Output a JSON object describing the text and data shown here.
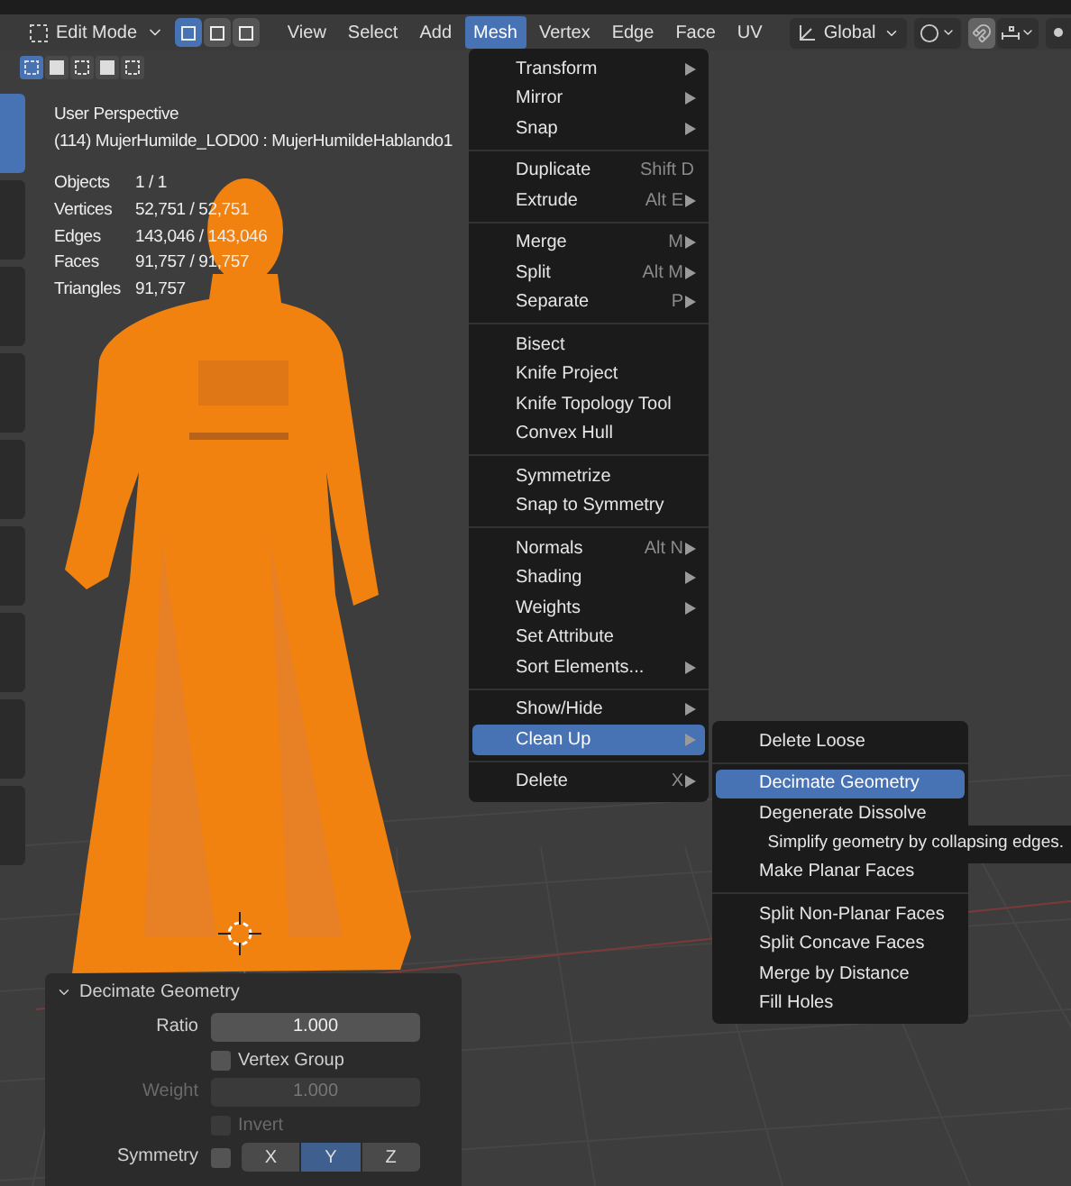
{
  "header": {
    "mode": "Edit Mode",
    "select_modes": [
      {
        "selected": true
      },
      {
        "selected": false
      },
      {
        "selected": false
      }
    ],
    "menus": [
      {
        "label": "View",
        "selected": false
      },
      {
        "label": "Select",
        "selected": false
      },
      {
        "label": "Add",
        "selected": false
      },
      {
        "label": "Mesh",
        "selected": true
      },
      {
        "label": "Vertex",
        "selected": false
      },
      {
        "label": "Edge",
        "selected": false
      },
      {
        "label": "Face",
        "selected": false
      },
      {
        "label": "UV",
        "selected": false
      }
    ],
    "orientation": "Global",
    "snap_on": true
  },
  "selection_tools": [
    {
      "selected": true
    },
    {
      "selected": false
    },
    {
      "selected": false
    },
    {
      "selected": false
    },
    {
      "selected": false
    }
  ],
  "toolbar": [
    {
      "selected": true
    },
    {
      "selected": false
    },
    {
      "selected": false
    },
    {
      "selected": false
    },
    {
      "selected": false
    },
    {
      "selected": false
    },
    {
      "selected": false
    },
    {
      "selected": false
    },
    {
      "selected": false
    }
  ],
  "viewport_info": {
    "view": "User Perspective",
    "object": "(114) MujerHumilde_LOD00 : MujerHumildeHablando1",
    "stats": [
      {
        "label": "Objects",
        "value": "1 / 1"
      },
      {
        "label": "Vertices",
        "value": "52,751 / 52,751"
      },
      {
        "label": "Edges",
        "value": "143,046 / 143,046"
      },
      {
        "label": "Faces",
        "value": "91,757 / 91,757"
      },
      {
        "label": "Triangles",
        "value": "91,757"
      }
    ]
  },
  "mesh_menu": [
    [
      {
        "label": "Transform",
        "submenu": true,
        "selected": false
      },
      {
        "label": "Mirror",
        "submenu": true,
        "selected": false
      },
      {
        "label": "Snap",
        "submenu": true,
        "selected": false
      }
    ],
    [
      {
        "label": "Duplicate",
        "shortcut": "Shift D",
        "submenu": false,
        "selected": false
      },
      {
        "label": "Extrude",
        "shortcut": "Alt E",
        "submenu": true,
        "selected": false
      }
    ],
    [
      {
        "label": "Merge",
        "shortcut": "M",
        "submenu": true,
        "selected": false
      },
      {
        "label": "Split",
        "shortcut": "Alt M",
        "submenu": true,
        "selected": false
      },
      {
        "label": "Separate",
        "shortcut": "P",
        "submenu": true,
        "selected": false
      }
    ],
    [
      {
        "label": "Bisect",
        "submenu": false,
        "selected": false
      },
      {
        "label": "Knife Project",
        "submenu": false,
        "selected": false
      },
      {
        "label": "Knife Topology Tool",
        "submenu": false,
        "selected": false
      },
      {
        "label": "Convex Hull",
        "submenu": false,
        "selected": false
      }
    ],
    [
      {
        "label": "Symmetrize",
        "submenu": false,
        "selected": false
      },
      {
        "label": "Snap to Symmetry",
        "submenu": false,
        "selected": false
      }
    ],
    [
      {
        "label": "Normals",
        "shortcut": "Alt N",
        "submenu": true,
        "selected": false
      },
      {
        "label": "Shading",
        "submenu": true,
        "selected": false
      },
      {
        "label": "Weights",
        "submenu": true,
        "selected": false
      },
      {
        "label": "Set Attribute",
        "submenu": false,
        "selected": false
      },
      {
        "label": "Sort Elements...",
        "submenu": true,
        "selected": false
      }
    ],
    [
      {
        "label": "Show/Hide",
        "submenu": true,
        "selected": false
      },
      {
        "label": "Clean Up",
        "submenu": true,
        "selected": true
      }
    ],
    [
      {
        "label": "Delete",
        "shortcut": "X",
        "submenu": true,
        "selected": false
      }
    ]
  ],
  "cleanup_menu": [
    [
      {
        "label": "Delete Loose",
        "submenu": false,
        "selected": false
      }
    ],
    [
      {
        "label": "Decimate Geometry",
        "submenu": false,
        "selected": true
      },
      {
        "label": "Degenerate Dissolve",
        "submenu": false,
        "selected": false
      },
      {
        "kind": "hidden"
      },
      {
        "label": "Make Planar Faces",
        "submenu": false,
        "selected": false
      }
    ],
    [
      {
        "label": "Split Non-Planar Faces",
        "submenu": false,
        "selected": false
      },
      {
        "label": "Split Concave Faces",
        "submenu": false,
        "selected": false
      },
      {
        "label": "Merge by Distance",
        "submenu": false,
        "selected": false
      },
      {
        "label": "Fill Holes",
        "submenu": false,
        "selected": false
      }
    ]
  ],
  "tooltip": "Simplify geometry by collapsing edges.",
  "operator_panel": {
    "title": "Decimate Geometry",
    "expanded": true,
    "ratio": {
      "label": "Ratio",
      "value": "1.000"
    },
    "vertex_group": {
      "label": "Vertex Group",
      "checked": false
    },
    "weight": {
      "label": "Weight",
      "value": "1.000",
      "disabled": true
    },
    "invert": {
      "label": "Invert",
      "checked": false,
      "disabled": true
    },
    "symmetry": {
      "label": "Symmetry",
      "checked": false,
      "axes": [
        {
          "label": "X",
          "selected": false
        },
        {
          "label": "Y",
          "selected": true
        },
        {
          "label": "Z",
          "selected": false
        }
      ]
    }
  }
}
